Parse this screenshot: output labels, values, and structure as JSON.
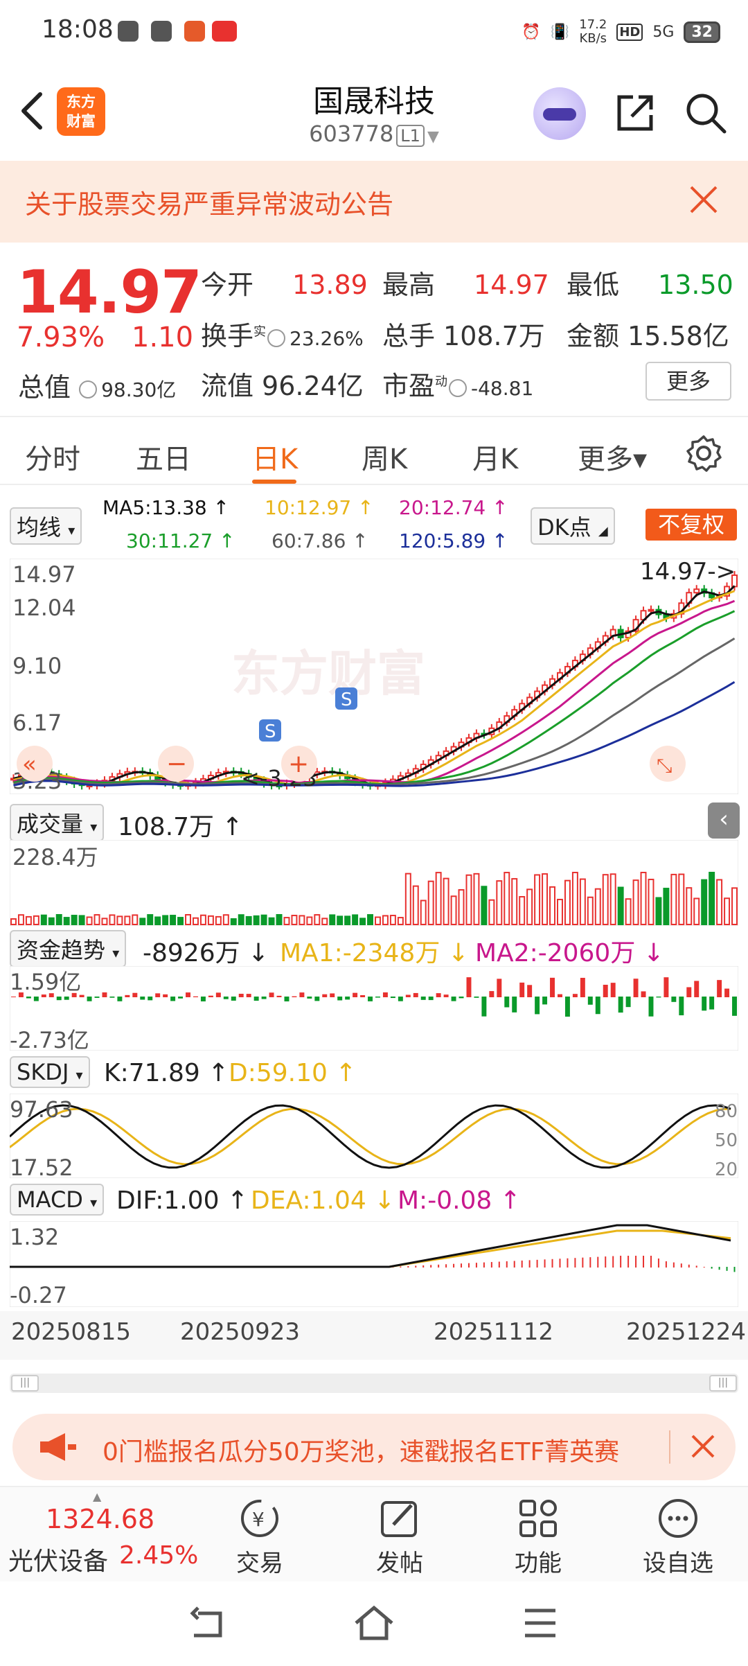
{
  "status": {
    "time": "18:08",
    "speed_top": "17.2",
    "speed_bottom": "KB/s",
    "signal": "5G",
    "hd": "HD",
    "battery": "32"
  },
  "header": {
    "logo_line1": "东方",
    "logo_line2": "财富",
    "name": "国晟科技",
    "code": "603778",
    "code_tag": "L1"
  },
  "notice": {
    "text": "关于股票交易严重异常波动公告"
  },
  "quote": {
    "price": "14.97",
    "pct": "7.93%",
    "change": "1.10",
    "total_mv_label": "总值",
    "total_mv": "98.30亿",
    "open_label": "今开",
    "open": "13.89",
    "high_label": "最高",
    "high": "14.97",
    "low_label": "最低",
    "low": "13.50",
    "turnover_label": "换手",
    "turnover_sup": "实",
    "turnover": "23.26%",
    "volume_label": "总手",
    "volume": "108.7万",
    "amount_label": "金额",
    "amount": "15.58亿",
    "float_label": "流值",
    "float_mv": "96.24亿",
    "pe_label": "市盈",
    "pe_sup": "动",
    "pe": "-48.81",
    "more": "更多"
  },
  "tabs": [
    {
      "label": "分时"
    },
    {
      "label": "五日"
    },
    {
      "label": "日K",
      "active": true
    },
    {
      "label": "周K"
    },
    {
      "label": "月K"
    },
    {
      "label": "更多▾"
    }
  ],
  "mabar": {
    "selector": "均线",
    "ma5": "MA5:13.38 ↑",
    "ma10": "10:12.97 ↑",
    "ma20": "20:12.74 ↑",
    "ma30": "30:11.27 ↑",
    "ma60": "60:7.86 ↑",
    "ma120": "120:5.89 ↑",
    "dk": "DK点",
    "fq": "不复权"
  },
  "kchart": {
    "y_labels": [
      "14.97",
      "12.04",
      "9.10",
      "6.17",
      "3.23"
    ],
    "max_label": "14.97->",
    "min_label": "<-3.23",
    "watermark": "东方财富",
    "s_mark": "S"
  },
  "volume": {
    "selector": "成交量",
    "value": "108.7万 ↑",
    "scale": "228.4万"
  },
  "capital": {
    "selector": "资金趋势",
    "value": "-8926万 ↓",
    "ma1": "MA1:-2348万 ↓",
    "ma2": "MA2:-2060万 ↓",
    "top": "1.59亿",
    "bottom": "-2.73亿"
  },
  "skdj": {
    "selector": "SKDJ",
    "k": "K:71.89 ↑",
    "d": "D:59.10 ↑",
    "top": "97.63",
    "bottom": "17.52",
    "r80": "80",
    "r50": "50",
    "r20": "20"
  },
  "macd": {
    "selector": "MACD",
    "dif": "DIF:1.00 ↑",
    "dea": "DEA:1.04 ↓",
    "m": "M:-0.08 ↑",
    "top": "1.32",
    "bottom": "-0.27"
  },
  "dates": [
    "20250815",
    "20250923",
    "20251112",
    "20251224"
  ],
  "promo": {
    "text": "0门槛报名瓜分50万奖池，速戳报名ETF菁英赛"
  },
  "bottom": {
    "index_value": "1324.68",
    "index_name": "光伏设备",
    "index_pct": "2.45%",
    "items": [
      {
        "label": "交易"
      },
      {
        "label": "发帖"
      },
      {
        "label": "功能"
      },
      {
        "label": "设自选"
      }
    ]
  },
  "colors": {
    "up": "#e8312f",
    "down": "#0a9a2a",
    "accent": "#f06a1a",
    "ma5": "#111111",
    "ma10": "#e8b418",
    "ma20": "#c8178c",
    "ma30": "#1a9e2a",
    "ma60": "#666666",
    "ma120": "#1c2f9a"
  }
}
